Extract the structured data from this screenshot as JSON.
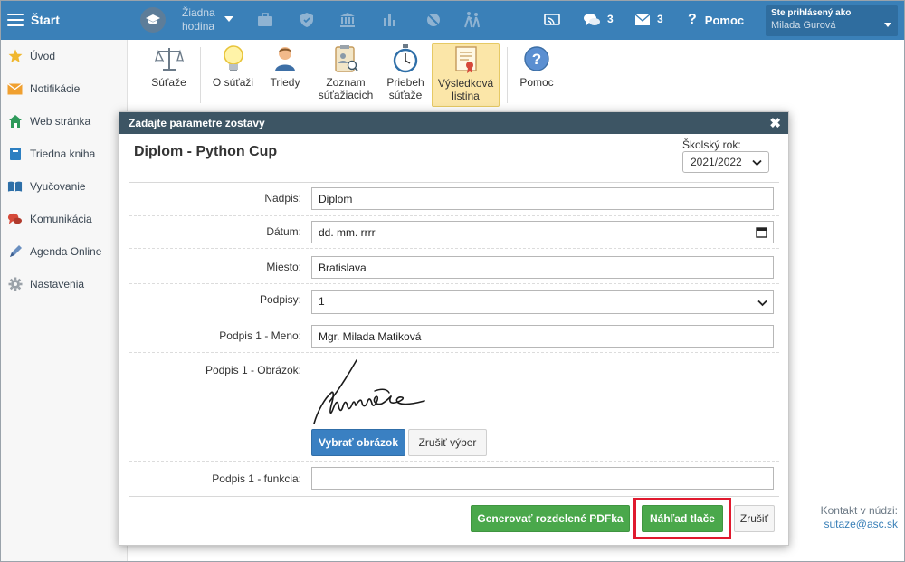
{
  "topbar": {
    "menu_title": "Štart",
    "lesson_line1": "Žiadna",
    "lesson_line2": "hodina",
    "chat_count": "3",
    "mail_count": "3",
    "help_label": "Pomoc",
    "user_heading": "Ste prihlásený ako",
    "user_name": "Milada Gurová",
    "icons": [
      "school-hat-icon",
      "briefcase-icon",
      "shield-icon",
      "bank-icon",
      "bar-chart-icon",
      "no-ball-icon",
      "students-icon",
      "cast-icon",
      "chat-icon",
      "mail-icon"
    ]
  },
  "sidebar": {
    "items": [
      {
        "label": "Úvod",
        "icon": "star-icon"
      },
      {
        "label": "Notifikácie",
        "icon": "envelope-icon"
      },
      {
        "label": "Web stránka",
        "icon": "home-icon"
      },
      {
        "label": "Triedna kniha",
        "icon": "book-icon"
      },
      {
        "label": "Vyučovanie",
        "icon": "open-book-icon"
      },
      {
        "label": "Komunikácia",
        "icon": "chat-bubbles-icon"
      },
      {
        "label": "Agenda Online",
        "icon": "pen-icon"
      },
      {
        "label": "Nastavenia",
        "icon": "gear-icon"
      }
    ]
  },
  "ribbon": {
    "items": [
      {
        "l1": "Súťaže",
        "l2": ""
      },
      {
        "l1": "O súťaži",
        "l2": ""
      },
      {
        "l1": "Triedy",
        "l2": ""
      },
      {
        "l1": "Zoznam",
        "l2": "súťažiacich"
      },
      {
        "l1": "Priebeh",
        "l2": "súťaže"
      },
      {
        "l1": "Výsledková",
        "l2": "listina"
      },
      {
        "l1": "Pomoc",
        "l2": ""
      }
    ]
  },
  "contact": {
    "label": "Kontakt v núdzi:",
    "email": "sutaze@asc.sk"
  },
  "dialog": {
    "header": "Zadajte parametre zostavy",
    "title": "Diplom - Python Cup",
    "year_label": "Školský rok:",
    "year_value": "2021/2022",
    "fields": {
      "nadpis_label": "Nadpis:",
      "nadpis_value": "Diplom",
      "datum_label": "Dátum:",
      "datum_value": "dd. mm. rrrr",
      "miesto_label": "Miesto:",
      "miesto_value": "Bratislava",
      "podpisy_label": "Podpisy:",
      "podpisy_value": "1",
      "meno_label": "Podpis 1 - Meno:",
      "meno_value": "Mgr. Milada Matiková",
      "obrazok_label": "Podpis 1 - Obrázok:",
      "funkcia_label": "Podpis 1 - funkcia:",
      "funkcia_value": ""
    },
    "buttons": {
      "choose_image": "Vybrať obrázok",
      "clear_selection": "Zrušiť výber",
      "generate_pdf": "Generovať rozdelené PDFka",
      "print_preview": "Náhľad tlače",
      "cancel": "Zrušiť"
    }
  },
  "colors": {
    "topbar": "#3a80b8",
    "dialog_header": "#3d5564",
    "green_button": "#4aa84b",
    "blue_button": "#3a80c2",
    "highlight": "#e0192e",
    "ribbon_active": "#fbe6a8"
  }
}
